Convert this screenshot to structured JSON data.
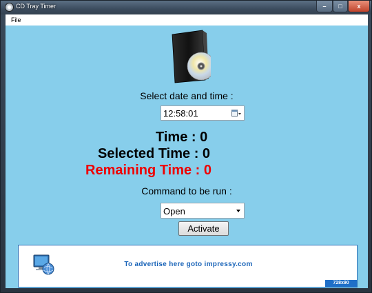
{
  "window": {
    "title": "CD Tray Timer",
    "controls": {
      "minimize": "–",
      "maximize": "□",
      "close": "x"
    }
  },
  "menu": {
    "file": "File"
  },
  "form": {
    "select_label": "Select date and time :",
    "time_value": "12:58:01",
    "time_label": "Time :",
    "time_count": "0",
    "selected_label": "Selected Time :",
    "selected_count": "0",
    "remaining_label": "Remaining Time :",
    "remaining_count": "0",
    "command_label": "Command to be run :",
    "command_value": "Open",
    "activate_label": "Activate"
  },
  "ad": {
    "text_prefix": "To advertise here goto ",
    "link_text": "impressy.com",
    "size_badge": "728x90"
  },
  "colors": {
    "client_bg": "#87ceeb",
    "remaining_text": "#ee0000",
    "ad_blue": "#1a64b8"
  }
}
